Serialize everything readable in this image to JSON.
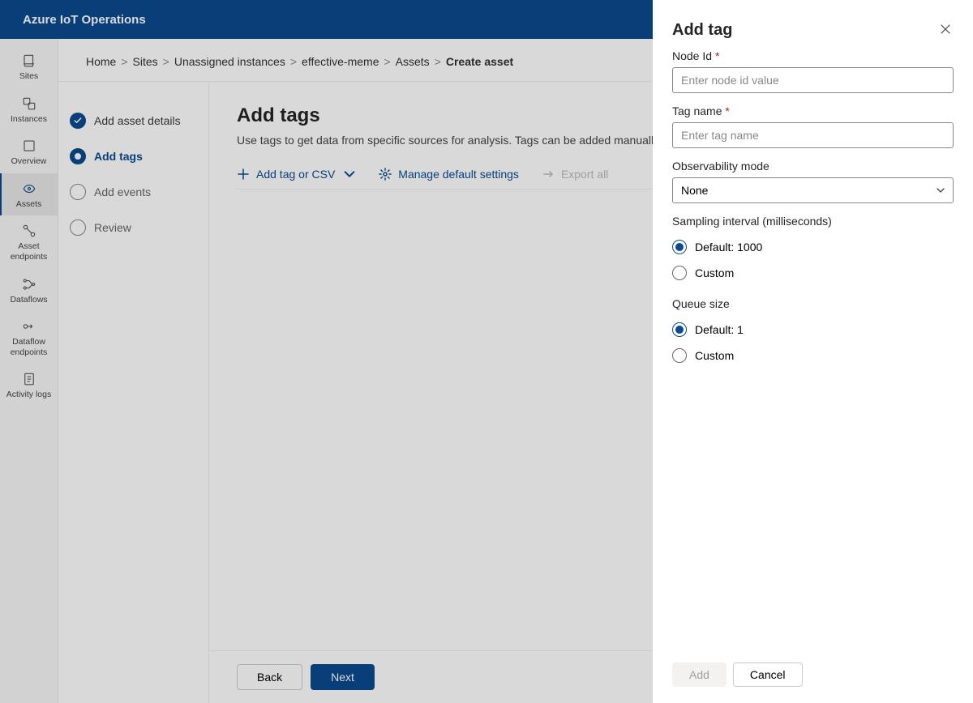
{
  "topbar": {
    "title": "Azure IoT Operations"
  },
  "leftnav": {
    "items": [
      {
        "label": "Sites"
      },
      {
        "label": "Instances"
      },
      {
        "label": "Overview"
      },
      {
        "label": "Assets"
      },
      {
        "label": "Asset endpoints"
      },
      {
        "label": "Dataflows"
      },
      {
        "label": "Dataflow endpoints"
      },
      {
        "label": "Activity logs"
      }
    ]
  },
  "breadcrumb": {
    "items": [
      "Home",
      "Sites",
      "Unassigned instances",
      "effective-meme",
      "Assets"
    ],
    "current": "Create asset"
  },
  "steps": {
    "items": [
      {
        "label": "Add asset details",
        "state": "done"
      },
      {
        "label": "Add tags",
        "state": "current"
      },
      {
        "label": "Add events",
        "state": "upcoming"
      },
      {
        "label": "Review",
        "state": "upcoming"
      }
    ]
  },
  "workspace": {
    "title": "Add tags",
    "subtitle": "Use tags to get data from specific sources for analysis. Tags can be added manually or from CSV file.",
    "commands": {
      "add_tag": "Add tag or CSV",
      "manage": "Manage default settings",
      "export": "Export all"
    }
  },
  "footer": {
    "back": "Back",
    "next": "Next"
  },
  "panel": {
    "title": "Add tag",
    "fields": {
      "node_id": {
        "label": "Node Id",
        "placeholder": "Enter node id value",
        "required": true
      },
      "tag_name": {
        "label": "Tag name",
        "placeholder": "Enter tag name",
        "required": true
      },
      "observability": {
        "label": "Observability mode",
        "value": "None"
      },
      "sampling": {
        "label": "Sampling interval (milliseconds)",
        "options": {
          "default": "Default: 1000",
          "custom": "Custom"
        },
        "selected": "default"
      },
      "queue": {
        "label": "Queue size",
        "options": {
          "default": "Default: 1",
          "custom": "Custom"
        },
        "selected": "default"
      }
    },
    "footer": {
      "add": "Add",
      "cancel": "Cancel"
    }
  }
}
